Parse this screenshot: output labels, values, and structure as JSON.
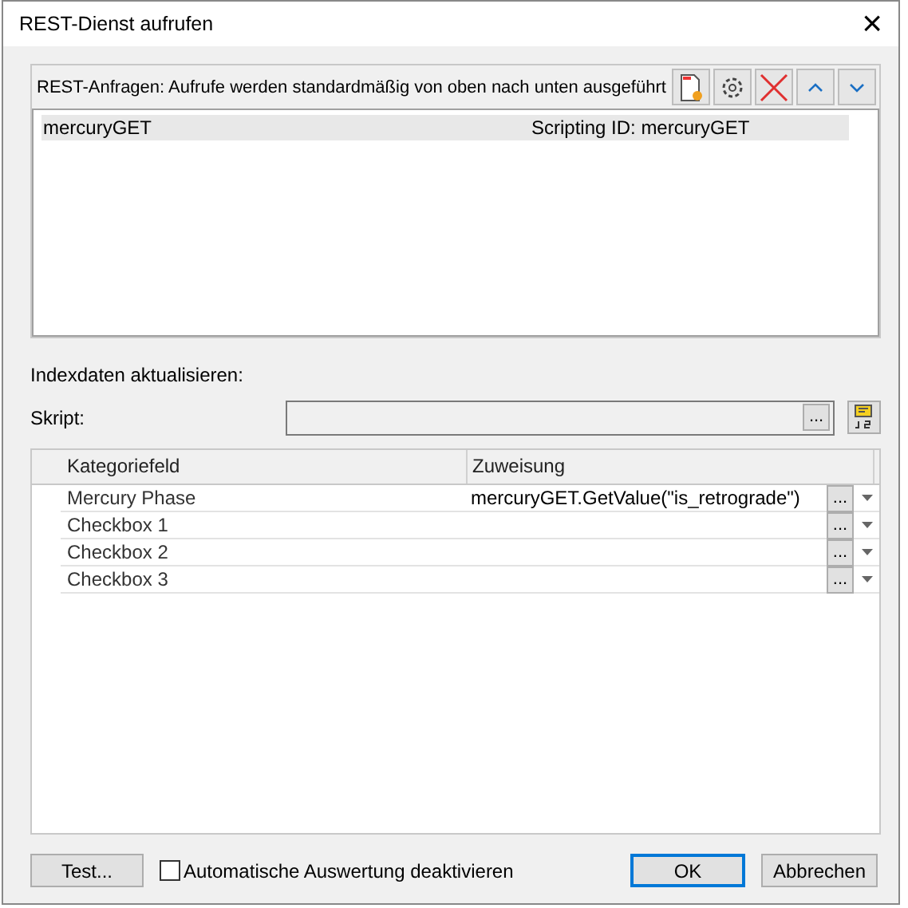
{
  "window": {
    "title": "REST-Dienst aufrufen",
    "close": "×"
  },
  "requests": {
    "header": "REST-Anfragen: Aufrufe werden standardmäßig von oben nach unten ausgeführt",
    "items": [
      {
        "name": "mercuryGET",
        "scripting_id": "Scripting ID: mercuryGET",
        "selected": true
      }
    ]
  },
  "index_label": "Indexdaten aktualisieren:",
  "script": {
    "label": "Skript:",
    "browse": "..."
  },
  "grid": {
    "columns": [
      "Kategoriefeld",
      "Zuweisung"
    ],
    "rows": [
      {
        "field": "Mercury Phase",
        "assignment": "mercuryGET.GetValue(\"is_retrograde\")",
        "browse": "..."
      },
      {
        "field": "Checkbox 1",
        "browse": "..."
      },
      {
        "field": "Checkbox 2",
        "browse": "..."
      },
      {
        "field": "Checkbox 3",
        "browse": "..."
      }
    ]
  },
  "footer": {
    "test": "Test...",
    "checkbox": {
      "label": "Automatische Auswertung deaktivieren",
      "checked": false
    },
    "ok": "OK",
    "cancel": "Abbrechen"
  }
}
